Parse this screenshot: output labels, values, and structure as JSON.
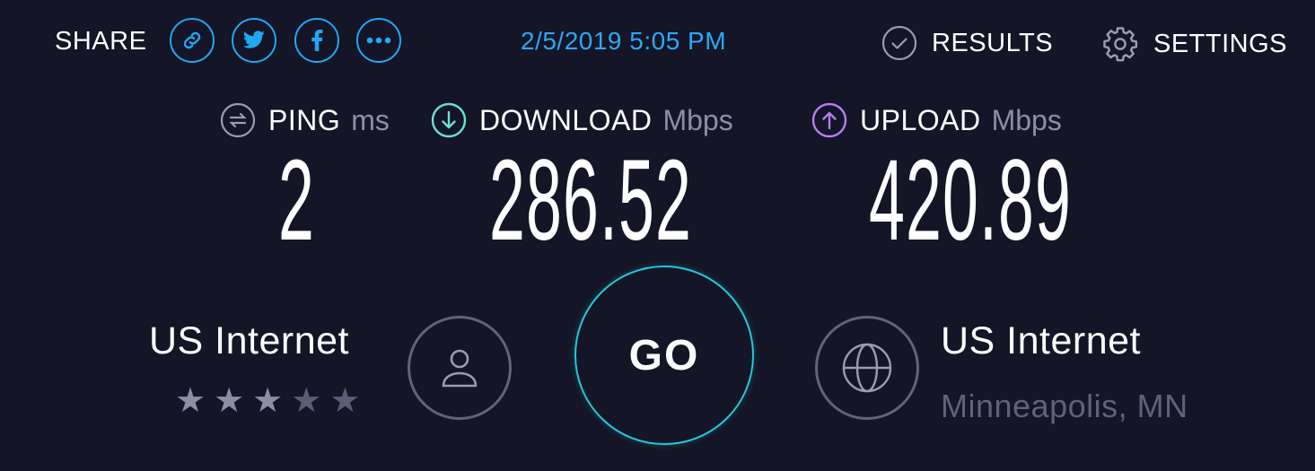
{
  "header": {
    "share_label": "SHARE",
    "share_buttons": [
      {
        "icon": "link-icon"
      },
      {
        "icon": "twitter-icon"
      },
      {
        "icon": "facebook-icon"
      },
      {
        "icon": "more-icon"
      }
    ],
    "timestamp": "2/5/2019 5:05 PM",
    "results_label": "RESULTS",
    "settings_label": "SETTINGS"
  },
  "metrics": {
    "ping": {
      "label": "PING",
      "unit": "ms",
      "value": "2",
      "icon": "ping-icon"
    },
    "download": {
      "label": "DOWNLOAD",
      "unit": "Mbps",
      "value": "286.52",
      "icon": "download-icon"
    },
    "upload": {
      "label": "UPLOAD",
      "unit": "Mbps",
      "value": "420.89",
      "icon": "upload-icon"
    }
  },
  "provider": {
    "name": "US Internet",
    "rating": 3,
    "rating_max": 5,
    "icon": "user-icon"
  },
  "go_label": "GO",
  "server": {
    "name": "US Internet",
    "location": "Minneapolis, MN",
    "icon": "globe-icon"
  },
  "colors": {
    "background": "#141526",
    "share_accent": "#1fa9f5",
    "timestamp": "#2ea7f4",
    "download_accent": "#6ae0d6",
    "upload_accent": "#b67cf0",
    "go_ring": "#27c7d8",
    "muted": "#8d8ea5"
  }
}
